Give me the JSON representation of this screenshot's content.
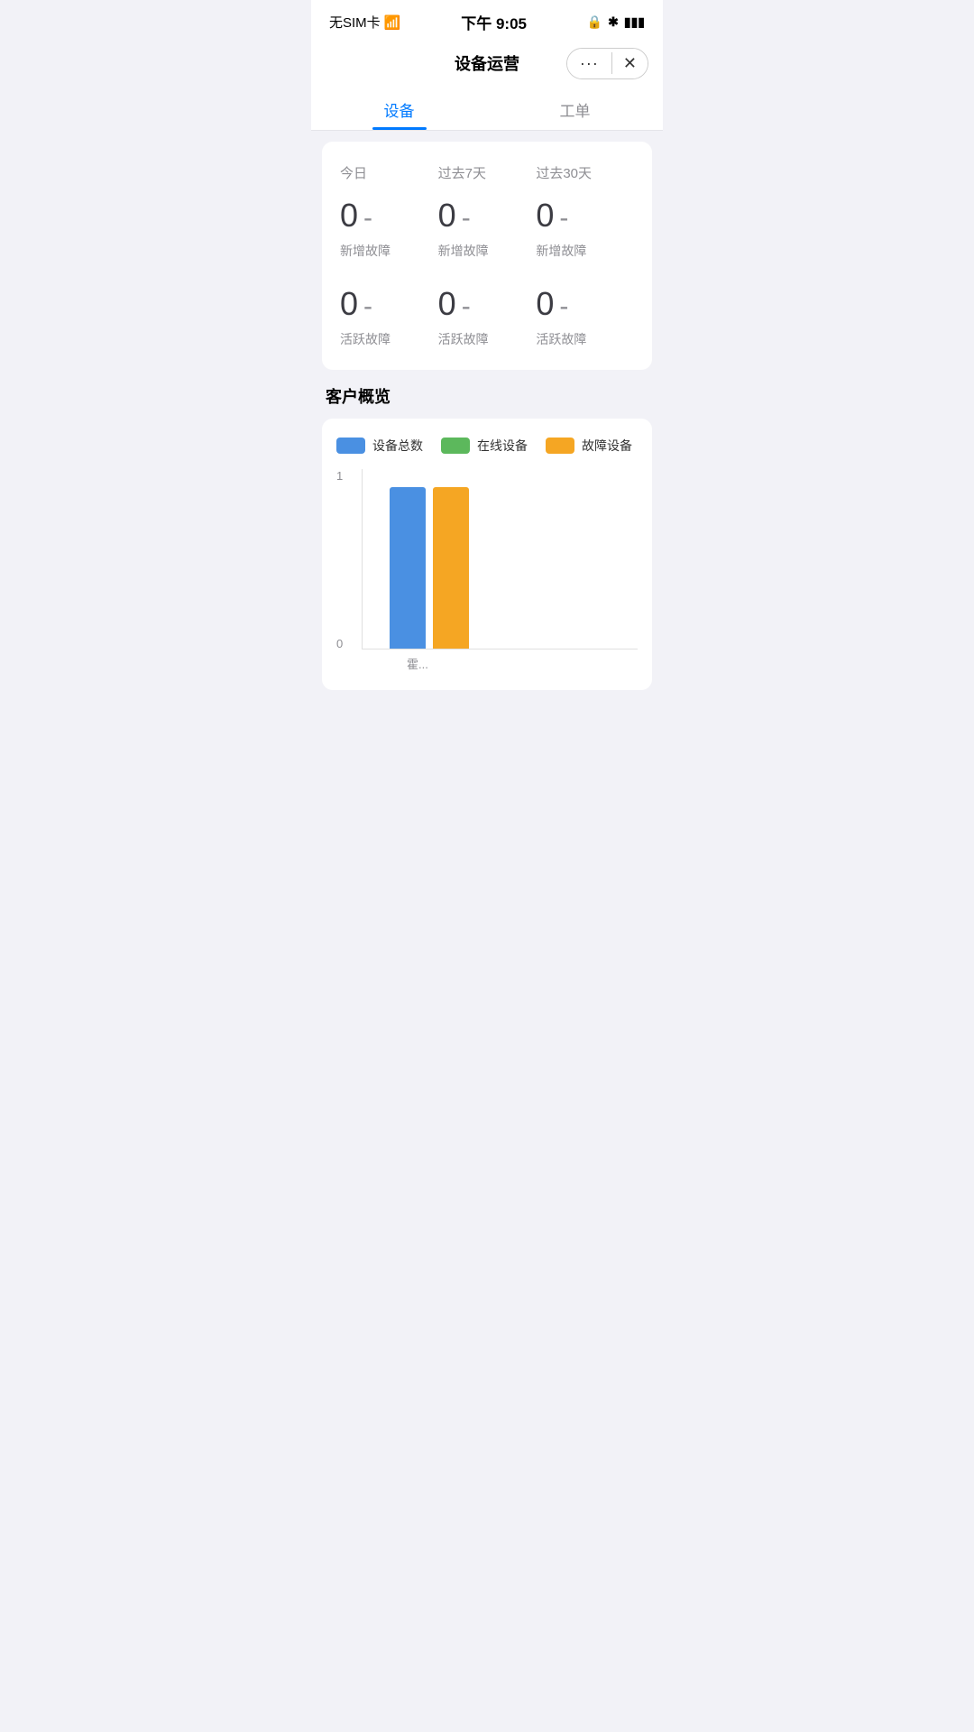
{
  "statusBar": {
    "left": "无SIM卡 ✦",
    "center": "下午 9:05",
    "wifi": "⟩",
    "lock": "⊕",
    "bluetooth": "✱",
    "battery": "▮▮▮"
  },
  "navBar": {
    "title": "设备运营",
    "dotsLabel": "···",
    "closeLabel": "✕"
  },
  "tabs": [
    {
      "id": "device",
      "label": "设备",
      "active": true
    },
    {
      "id": "workorder",
      "label": "工单",
      "active": false
    }
  ],
  "statsCard": {
    "headers": [
      "今日",
      "过去7天",
      "过去30天"
    ],
    "newFaultLabel": "新增故障",
    "activeFaultLabel": "活跃故障",
    "newFaultValues": [
      "0",
      "0",
      "0"
    ],
    "activeFaultValues": [
      "0",
      "0",
      "0"
    ],
    "dash": "-"
  },
  "customerOverview": {
    "title": "客户概览",
    "legend": [
      {
        "label": "设备总数",
        "color": "#4a90e2"
      },
      {
        "label": "在线设备",
        "color": "#5cb85c"
      },
      {
        "label": "故障设备",
        "color": "#f5a623"
      }
    ],
    "chart": {
      "yAxisMax": "1",
      "yAxisMin": "0",
      "bars": [
        {
          "type": "blue",
          "height": 90,
          "colorClass": "bar-blue"
        },
        {
          "type": "orange",
          "height": 90,
          "colorClass": "bar-orange"
        }
      ],
      "xLabel": "霍..."
    }
  }
}
